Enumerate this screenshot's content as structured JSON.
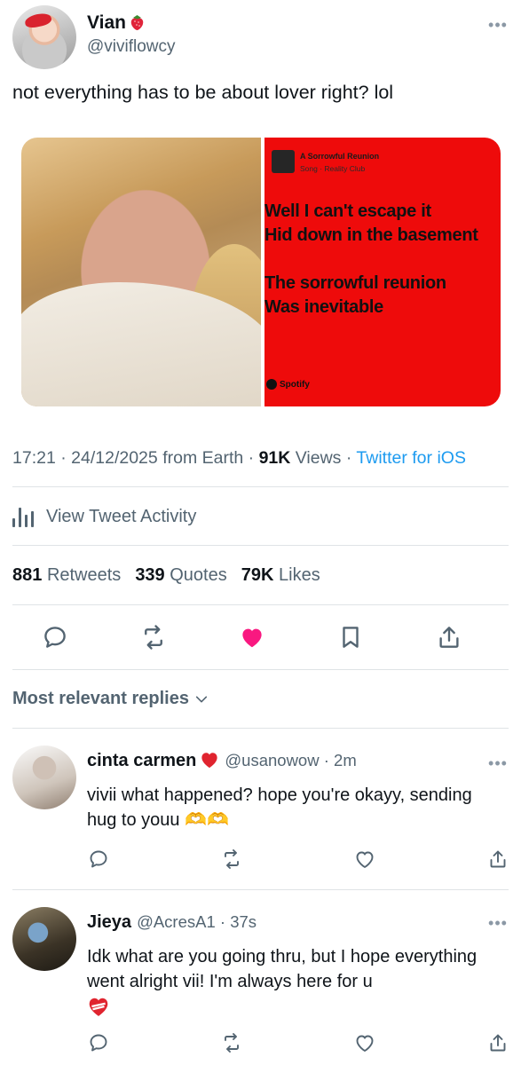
{
  "tweet": {
    "author": {
      "display_name": "Vian",
      "handle": "@viviflowcy"
    },
    "text": "not everything has to be about lover right? lol",
    "media": {
      "spotify_card": {
        "song_title": "A Sorrowful Reunion",
        "song_subtitle": "Song · Reality Club",
        "lyrics": "Well I can't escape it\nHid down in the basement\n\nThe sorrowful reunion\nWas inevitable",
        "logo_text": "Spotify"
      }
    },
    "meta": {
      "time": "17:21",
      "date": "24/12/2025",
      "location": "from Earth",
      "views_count": "91K",
      "views_label": "Views",
      "client": "Twitter for iOS"
    },
    "activity_label": "View Tweet Activity",
    "stats": {
      "retweets_count": "881",
      "retweets_label": "Retweets",
      "quotes_count": "339",
      "quotes_label": "Quotes",
      "likes_count": "79K",
      "likes_label": "Likes"
    },
    "liked": true
  },
  "replies_sort_label": "Most relevant replies",
  "replies": [
    {
      "display_name": "cinta carmen",
      "handle": "@usanowow · 2m",
      "text": "vivii what happened? hope you're okayy, sending hug to youu 🫶🫶"
    },
    {
      "display_name": "Jieya",
      "handle": "@AcresA1 · 37s",
      "text": "Idk what are you going thru, but I hope everything went alright vii! I'm always here for u"
    }
  ],
  "colors": {
    "accent": "#1d9bf0",
    "like": "#f91880",
    "secondary_text": "#536471",
    "spotify_card_bg": "#ee0b0b"
  }
}
